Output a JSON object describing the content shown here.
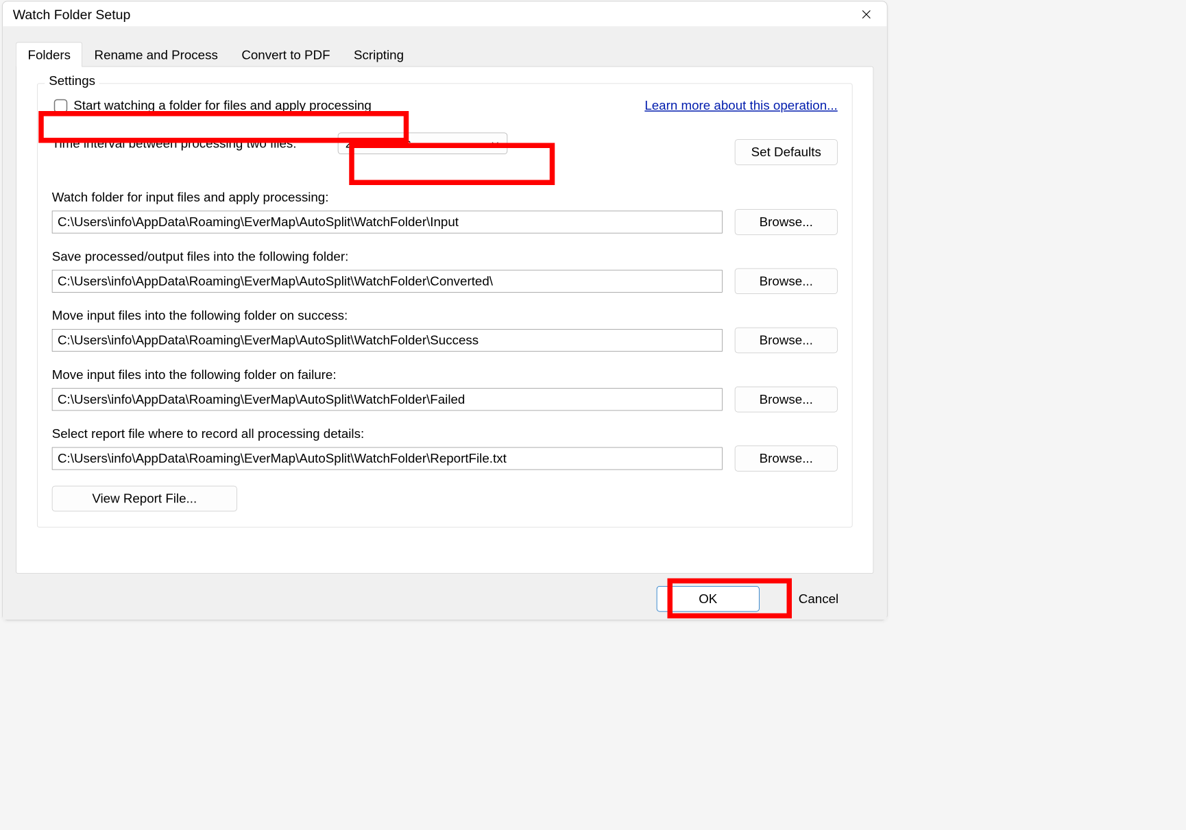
{
  "title": "Watch Folder Setup",
  "tabs": [
    "Folders",
    "Rename and Process",
    "Convert to PDF",
    "Scripting"
  ],
  "active_tab": "Folders",
  "settings": {
    "group_label": "Settings",
    "start_watching_label": "Start watching a folder for files and apply processing",
    "start_watching_checked": false,
    "learn_more": "Learn more about this operation...",
    "interval_label": "Time interval between processing two files:",
    "interval_value": "20 seconds",
    "set_defaults": "Set Defaults",
    "blocks": [
      {
        "label": "Watch folder for input files and apply processing:",
        "value": "C:\\Users\\info\\AppData\\Roaming\\EverMap\\AutoSplit\\WatchFolder\\Input",
        "browse": "Browse..."
      },
      {
        "label": "Save processed/output files into the following folder:",
        "value": "C:\\Users\\info\\AppData\\Roaming\\EverMap\\AutoSplit\\WatchFolder\\Converted\\",
        "browse": "Browse..."
      },
      {
        "label": "Move input files into the following folder on success:",
        "value": "C:\\Users\\info\\AppData\\Roaming\\EverMap\\AutoSplit\\WatchFolder\\Success",
        "browse": "Browse..."
      },
      {
        "label": "Move input files into the following folder on failure:",
        "value": "C:\\Users\\info\\AppData\\Roaming\\EverMap\\AutoSplit\\WatchFolder\\Failed",
        "browse": "Browse..."
      },
      {
        "label": "Select report file where to record all processing details:",
        "value": "C:\\Users\\info\\AppData\\Roaming\\EverMap\\AutoSplit\\WatchFolder\\ReportFile.txt",
        "browse": "Browse..."
      }
    ],
    "view_report": "View Report File..."
  },
  "buttons": {
    "ok": "OK",
    "cancel": "Cancel"
  }
}
